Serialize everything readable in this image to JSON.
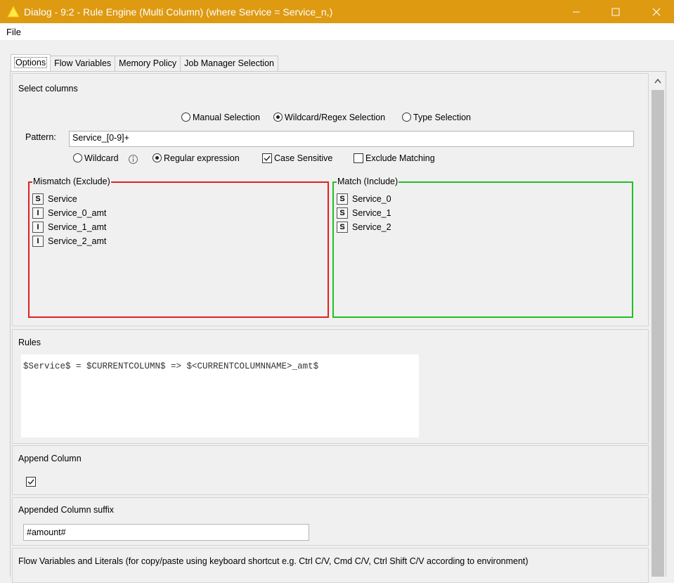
{
  "window": {
    "title": "Dialog - 9:2 - Rule Engine (Multi Column) (where Service = Service_n,)",
    "accent_color": "#de9a11"
  },
  "menu": [
    "File"
  ],
  "tabs": [
    "Options",
    "Flow Variables",
    "Memory Policy",
    "Job Manager Selection"
  ],
  "active_tab": "Options",
  "select_columns": {
    "title": "Select columns",
    "modes": [
      "Manual Selection",
      "Wildcard/Regex Selection",
      "Type Selection"
    ],
    "selected_mode": "Wildcard/Regex Selection",
    "pattern_label": "Pattern:",
    "pattern_value": "Service_[0-9]+",
    "pattern_types": [
      "Wildcard",
      "Regular expression"
    ],
    "selected_pattern_type": "Regular expression",
    "info_icon": "info-icon",
    "case_sensitive_label": "Case Sensitive",
    "case_sensitive": true,
    "exclude_matching_label": "Exclude Matching",
    "exclude_matching": false,
    "mismatch": {
      "legend": "Mismatch (Exclude)",
      "color": "#e02020",
      "items": [
        {
          "type": "S",
          "name": "Service"
        },
        {
          "type": "I",
          "name": "Service_0_amt"
        },
        {
          "type": "I",
          "name": "Service_1_amt"
        },
        {
          "type": "I",
          "name": "Service_2_amt"
        }
      ]
    },
    "match": {
      "legend": "Match (Include)",
      "color": "#20c020",
      "items": [
        {
          "type": "S",
          "name": "Service_0"
        },
        {
          "type": "S",
          "name": "Service_1"
        },
        {
          "type": "S",
          "name": "Service_2"
        }
      ]
    }
  },
  "rules": {
    "title": "Rules",
    "code": "$Service$ = $CURRENTCOLUMN$ => $<CURRENTCOLUMNNAME>_amt$"
  },
  "append_column": {
    "title": "Append Column",
    "checked": true
  },
  "suffix": {
    "title": "Appended Column suffix",
    "value": "#amount#"
  },
  "flow_vars": {
    "title": "Flow Variables and Literals (for copy/paste using keyboard shortcut e.g. Ctrl C/V, Cmd C/V, Ctrl Shift C/V according to environment)"
  }
}
